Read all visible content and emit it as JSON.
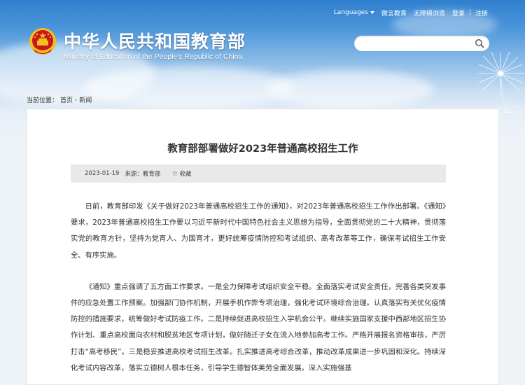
{
  "header": {
    "top_links": {
      "languages": "Languages",
      "weibo": "微言教育",
      "accessibility": "无障碍浏览",
      "login": "登录",
      "separator": "|",
      "register": "注册"
    },
    "site_title": "中华人民共和国教育部",
    "site_subtitle": "Ministry of Education of the People's Republic of China",
    "search": {
      "placeholder": "",
      "icon": "search-icon"
    }
  },
  "breadcrumb": {
    "label": "当前位置：",
    "items": [
      "首页",
      "新闻"
    ],
    "separator": "›"
  },
  "article": {
    "title": "教育部部署做好2023年普通高校招生工作",
    "date": "2023-01-19",
    "source": "来源：教育部",
    "favorite_label": "收藏",
    "paragraphs": [
      "日前，教育部印发《关于做好2023年普通高校招生工作的通知》，对2023年普通高校招生工作作出部署。《通知》要求，2023年普通高校招生工作要以习近平新时代中国特色社会主义思想为指导，全面贯彻党的二十大精神，贯彻落实党的教育方针，坚持为党育人、为国育才，更好统筹疫情防控和考试组织、高考改革等工作，确保考试招生工作安全、有序实施。",
      "《通知》重点强调了五方面工作要求。一是全力保障考试组织安全平稳。全面落实考试安全责任，完善各类突发事件的应急处置工作预案。加强部门协作机制，开展手机作弊专项治理，强化考试环境综合治理。认真落实有关优化疫情防控的措施要求，统筹做好考试防疫工作。二是持续促进高校招生入学机会公平。继续实施国家支援中西部地区招生协作计划、重点高校面向农村和脱贫地区专项计划，做好随迁子女在流入地参加高考工作。严格开展报名资格审核，严厉打击“高考移民”。三是稳妥推进高校考试招生改革。扎实推进高考综合改革，推动改革成果进一步巩固和深化。持续深化考试内容改革，落实立德树人根本任务，引导学生德智体美劳全面发展。深入实施强基"
    ]
  },
  "colors": {
    "sky_top": "#2f7fcf",
    "page_bg": "#dfe9f4",
    "meta_bar": "#e9e9e9",
    "emblem_red": "#c8161d",
    "emblem_gold": "#f0c020"
  }
}
